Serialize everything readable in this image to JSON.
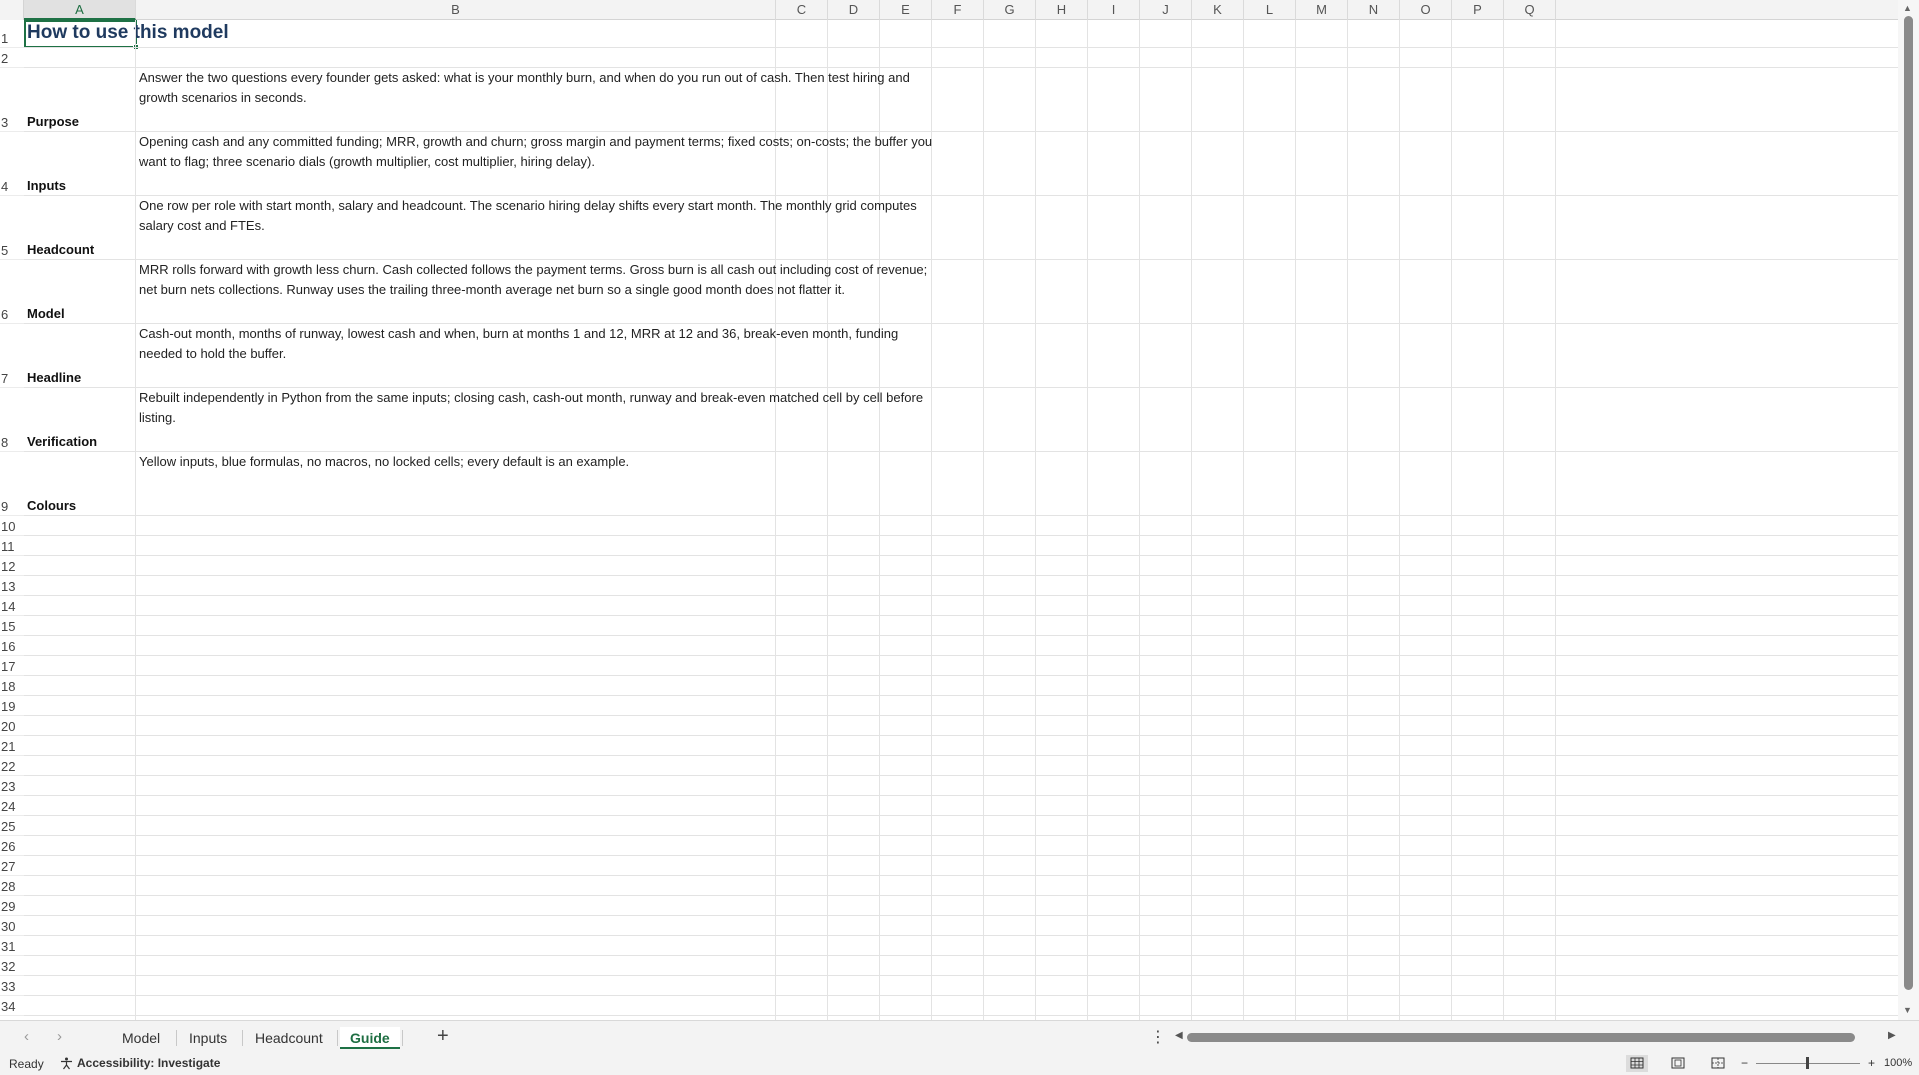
{
  "columns": [
    "A",
    "B",
    "C",
    "D",
    "E",
    "F",
    "G",
    "H",
    "I",
    "J",
    "K",
    "L",
    "M",
    "N",
    "O",
    "P",
    "Q"
  ],
  "selected_column": "A",
  "rows": [
    "1",
    "2",
    "3",
    "4",
    "5",
    "6",
    "7",
    "8",
    "9",
    "10",
    "11",
    "12",
    "13",
    "14",
    "15",
    "16",
    "17",
    "18",
    "19",
    "20",
    "21",
    "22",
    "23",
    "24",
    "25",
    "26",
    "27",
    "28",
    "29",
    "30",
    "31",
    "32",
    "33",
    "34"
  ],
  "sheet": {
    "title": "How to use this model",
    "entries": [
      {
        "label": "Purpose",
        "text": "Answer the two questions every founder gets asked: what is your monthly burn, and when do you run out of cash. Then test hiring and growth scenarios in seconds."
      },
      {
        "label": "Inputs",
        "text": "Opening cash and any committed funding; MRR, growth and churn; gross margin and payment terms; fixed costs; on-costs; the buffer you want to flag; three scenario dials (growth multiplier, cost multiplier, hiring delay)."
      },
      {
        "label": "Headcount",
        "text": "One row per role with start month, salary and headcount. The scenario hiring delay shifts every start month. The monthly grid computes salary cost and FTEs."
      },
      {
        "label": "Model",
        "text": "MRR rolls forward with growth less churn. Cash collected follows the payment terms. Gross burn is all cash out including cost of revenue; net burn nets collections. Runway uses the trailing three-month average net burn so a single good month does not flatter it."
      },
      {
        "label": "Headline",
        "text": "Cash-out month, months of runway, lowest cash and when, burn at months 1 and 12, MRR at 12 and 36, break-even month, funding needed to hold the buffer."
      },
      {
        "label": "Verification",
        "text": "Rebuilt independently in Python from the same inputs; closing cash, cash-out month, runway and break-even matched cell by cell before listing."
      },
      {
        "label": "Colours",
        "text": "Yellow inputs, blue formulas, no macros, no locked cells; every default is an example."
      }
    ]
  },
  "tabs": [
    {
      "label": "Model",
      "active": false
    },
    {
      "label": "Inputs",
      "active": false
    },
    {
      "label": "Headcount",
      "active": false
    },
    {
      "label": "Guide",
      "active": true
    }
  ],
  "status": {
    "ready": "Ready",
    "accessibility": "Accessibility: Investigate",
    "zoom": "100%"
  },
  "colors": {
    "accent": "#1e7145",
    "title": "#1f3a5f"
  }
}
